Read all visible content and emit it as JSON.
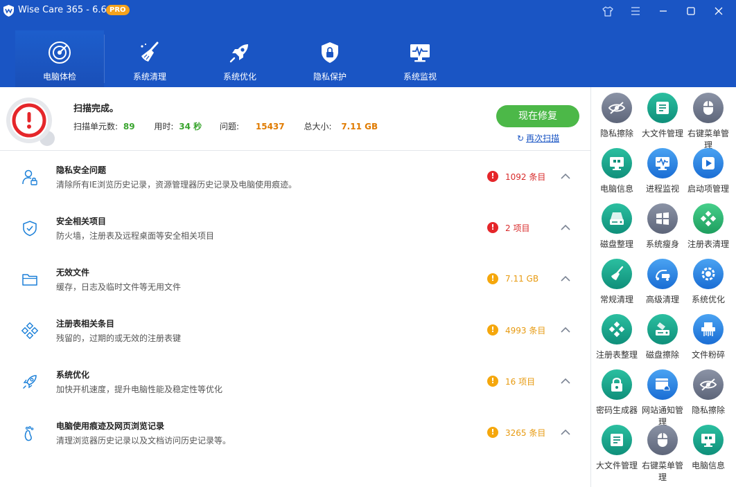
{
  "app": {
    "title": "Wise Care 365 - 6.6.6",
    "badge": "PRO",
    "accent": "#1a55c4"
  },
  "window_controls": [
    {
      "name": "skin-icon"
    },
    {
      "name": "menu-icon"
    },
    {
      "name": "minimize-icon"
    },
    {
      "name": "maximize-icon"
    },
    {
      "name": "close-icon"
    }
  ],
  "nav": {
    "tabs": [
      {
        "label": "电脑体检",
        "icon": "radar-icon",
        "active": true
      },
      {
        "label": "系统清理",
        "icon": "broom-icon",
        "active": false
      },
      {
        "label": "系统优化",
        "icon": "rocket-icon",
        "active": false
      },
      {
        "label": "隐私保护",
        "icon": "shield-lock-icon",
        "active": false
      },
      {
        "label": "系统监视",
        "icon": "monitor-pulse-icon",
        "active": false
      }
    ]
  },
  "summary": {
    "title": "扫描完成。",
    "scanned_label": "扫描单元数:",
    "scanned_value": "89",
    "time_label": "用时:",
    "time_value": "34 秒",
    "issues_label": "问题:",
    "issues_value": "15437",
    "size_label": "总大小:",
    "size_value": "7.11 GB",
    "fix_button": "现在修复",
    "rescan_link": "再次扫描"
  },
  "issues": [
    {
      "title": "隐私安全问题",
      "desc": "清除所有IE浏览历史记录，资源管理器历史记录及电脑使用痕迹。",
      "status": "1092 条目",
      "level": "red",
      "icon": "user-lock-icon"
    },
    {
      "title": "安全相关项目",
      "desc": "防火墙，注册表及远程桌面等安全相关项目",
      "status": "2 项目",
      "level": "red",
      "icon": "shield-check-icon"
    },
    {
      "title": "无效文件",
      "desc": "缓存，日志及临时文件等无用文件",
      "status": "7.11 GB",
      "level": "yellow",
      "icon": "folder-icon"
    },
    {
      "title": "注册表相关条目",
      "desc": "残留的，过期的或无效的注册表键",
      "status": "4993 条目",
      "level": "yellow",
      "icon": "registry-icon"
    },
    {
      "title": "系统优化",
      "desc": "加快开机速度，提升电脑性能及稳定性等优化",
      "status": "16 项目",
      "level": "yellow",
      "icon": "rocket-icon"
    },
    {
      "title": "电脑使用痕迹及网页浏览记录",
      "desc": "清理浏览器历史记录以及文档访问历史记录等。",
      "status": "3265 条目",
      "level": "yellow",
      "icon": "footprint-icon"
    }
  ],
  "tools": [
    {
      "label": "隐私擦除",
      "color": "gray",
      "icon": "eye-off-icon"
    },
    {
      "label": "大文件管理",
      "color": "teal",
      "icon": "file-list-icon"
    },
    {
      "label": "右键菜单管理",
      "color": "gray",
      "icon": "mouse-icon"
    },
    {
      "label": "电脑信息",
      "color": "teal",
      "icon": "monitor-grid-icon"
    },
    {
      "label": "进程监视",
      "color": "blue",
      "icon": "monitor-pulse-icon"
    },
    {
      "label": "启动项管理",
      "color": "blue",
      "icon": "play-icon"
    },
    {
      "label": "磁盘整理",
      "color": "teal",
      "icon": "disk-icon"
    },
    {
      "label": "系统瘦身",
      "color": "gray",
      "icon": "windows-icon"
    },
    {
      "label": "注册表清理",
      "color": "green",
      "icon": "registry-icon"
    },
    {
      "label": "常规清理",
      "color": "teal",
      "icon": "broom-icon"
    },
    {
      "label": "高级清理",
      "color": "blue",
      "icon": "vacuum-icon"
    },
    {
      "label": "系统优化",
      "color": "blue",
      "icon": "gear-icon"
    },
    {
      "label": "注册表整理",
      "color": "teal",
      "icon": "registry-icon"
    },
    {
      "label": "磁盘擦除",
      "color": "teal",
      "icon": "disk-wipe-icon"
    },
    {
      "label": "文件粉碎",
      "color": "blue",
      "icon": "shredder-icon"
    },
    {
      "label": "密码生成器",
      "color": "teal",
      "icon": "lock-icon"
    },
    {
      "label": "网站通知管理",
      "color": "blue",
      "icon": "web-bell-icon"
    },
    {
      "label": "隐私擦除",
      "color": "gray",
      "icon": "eye-off-icon"
    },
    {
      "label": "大文件管理",
      "color": "teal",
      "icon": "file-list-icon"
    },
    {
      "label": "右键菜单管理",
      "color": "gray",
      "icon": "mouse-icon"
    },
    {
      "label": "电脑信息",
      "color": "teal",
      "icon": "monitor-grid-icon"
    }
  ]
}
